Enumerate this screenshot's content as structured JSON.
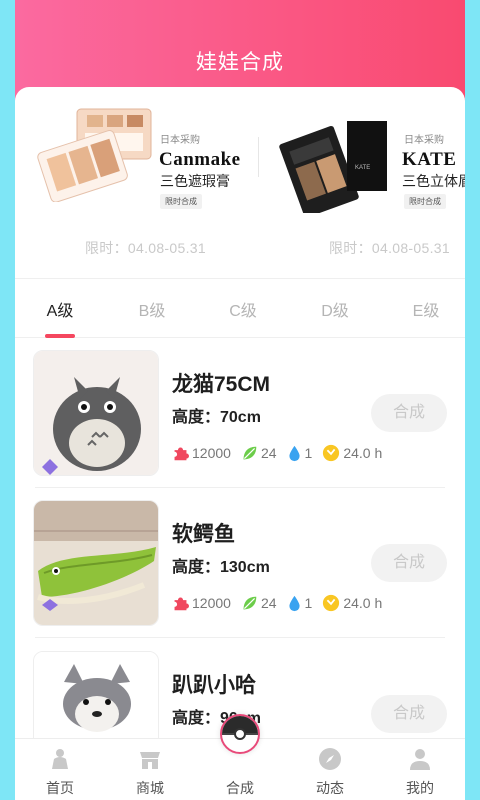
{
  "header": {
    "title": "娃娃合成"
  },
  "promos": [
    {
      "tag": "日本采购",
      "brand": "Canmake",
      "name": "三色遮瑕膏",
      "limited": "限时合成",
      "date": "限时：04.08-05.31"
    },
    {
      "tag": "日本采购",
      "brand": "KATE",
      "name": "三色立体眉",
      "limited": "限时合成",
      "date": "限时：04.08-05.31"
    }
  ],
  "tabs": [
    "A级",
    "B级",
    "C级",
    "D级",
    "E级"
  ],
  "active_tab": "A级",
  "items": [
    {
      "title": "龙猫75CM",
      "height": "高度：70cm",
      "button": "合成",
      "coins": "12000",
      "leaves": "24",
      "drops": "1",
      "time": "24.0 h"
    },
    {
      "title": "软鳄鱼",
      "height": "高度：130cm",
      "button": "合成",
      "coins": "12000",
      "leaves": "24",
      "drops": "1",
      "time": "24.0 h"
    },
    {
      "title": "趴趴小哈",
      "height": "高度：90cm",
      "button": "合成"
    }
  ],
  "tabbar": [
    {
      "label": "首页",
      "icon": "home-icon"
    },
    {
      "label": "商城",
      "icon": "shop-icon"
    },
    {
      "label": "合成",
      "icon": "combine-icon"
    },
    {
      "label": "动态",
      "icon": "compass-icon"
    },
    {
      "label": "我的",
      "icon": "user-icon"
    }
  ],
  "colors": {
    "header_start": "#fb6aa0",
    "header_end": "#f94a70",
    "accent": "#f5475f",
    "background": "#7ee6f6"
  }
}
